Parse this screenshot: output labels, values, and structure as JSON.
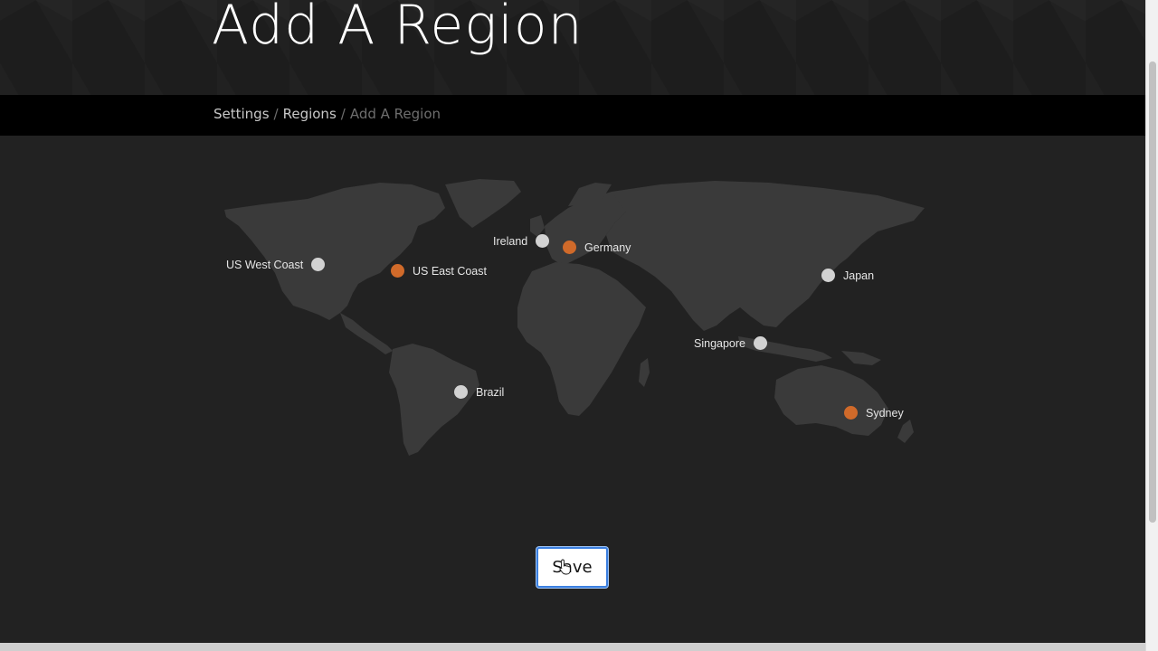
{
  "header": {
    "title": "Add A Region"
  },
  "breadcrumb": {
    "items": [
      {
        "label": "Settings"
      },
      {
        "label": "Regions"
      }
    ],
    "current": "Add A Region",
    "separator": "/"
  },
  "map": {
    "regions": [
      {
        "name": "US West Coast",
        "selected": false
      },
      {
        "name": "US East Coast",
        "selected": true
      },
      {
        "name": "Ireland",
        "selected": false
      },
      {
        "name": "Germany",
        "selected": true
      },
      {
        "name": "Japan",
        "selected": false
      },
      {
        "name": "Singapore",
        "selected": false
      },
      {
        "name": "Brazil",
        "selected": false
      },
      {
        "name": "Sydney",
        "selected": true
      }
    ],
    "colors": {
      "selected": "#d06a2a",
      "unselected": "#d2d2d2",
      "land": "#3a3a3a"
    }
  },
  "actions": {
    "save_label": "Save"
  },
  "icons": {
    "cursor": "hand-pointer-icon"
  }
}
